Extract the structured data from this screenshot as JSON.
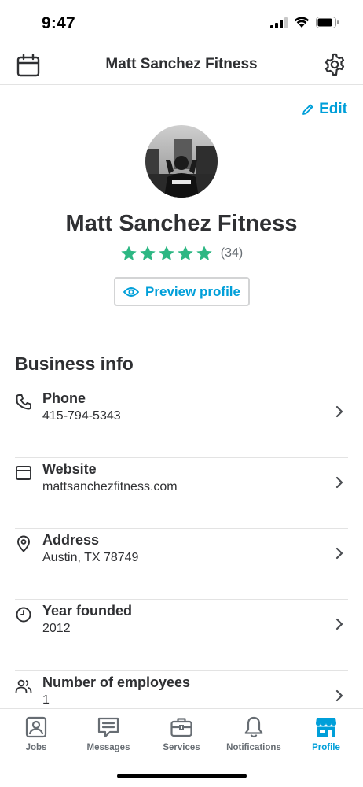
{
  "status_bar": {
    "time": "9:47"
  },
  "header": {
    "title": "Matt Sanchez Fitness",
    "left_icon": "calendar-icon",
    "right_icon": "gear-icon"
  },
  "profile": {
    "edit_label": "Edit",
    "name": "Matt Sanchez Fitness",
    "rating_stars": 5,
    "review_count": "(34)",
    "preview_label": "Preview profile"
  },
  "business_info": {
    "title": "Business info",
    "rows": [
      {
        "label": "Phone",
        "value": "415-794-5343",
        "icon": "phone-icon"
      },
      {
        "label": "Website",
        "value": "mattsanchezfitness.com",
        "icon": "browser-window-icon"
      },
      {
        "label": "Address",
        "value": "Austin, TX 78749",
        "icon": "location-pin-icon"
      },
      {
        "label": "Year founded",
        "value": "2012",
        "icon": "clock-icon"
      },
      {
        "label": "Number of employees",
        "value": "1",
        "icon": "people-icon"
      }
    ]
  },
  "bottom_nav": {
    "items": [
      {
        "label": "Jobs",
        "icon": "jobs-icon"
      },
      {
        "label": "Messages",
        "icon": "messages-icon"
      },
      {
        "label": "Services",
        "icon": "briefcase-icon"
      },
      {
        "label": "Notifications",
        "icon": "bell-icon"
      },
      {
        "label": "Profile",
        "icon": "storefront-icon",
        "active": true
      }
    ]
  },
  "colors": {
    "accent": "#009fd9",
    "star": "#2db783",
    "text": "#2f3033",
    "muted": "#676d73",
    "divider": "#e3e3e3"
  }
}
